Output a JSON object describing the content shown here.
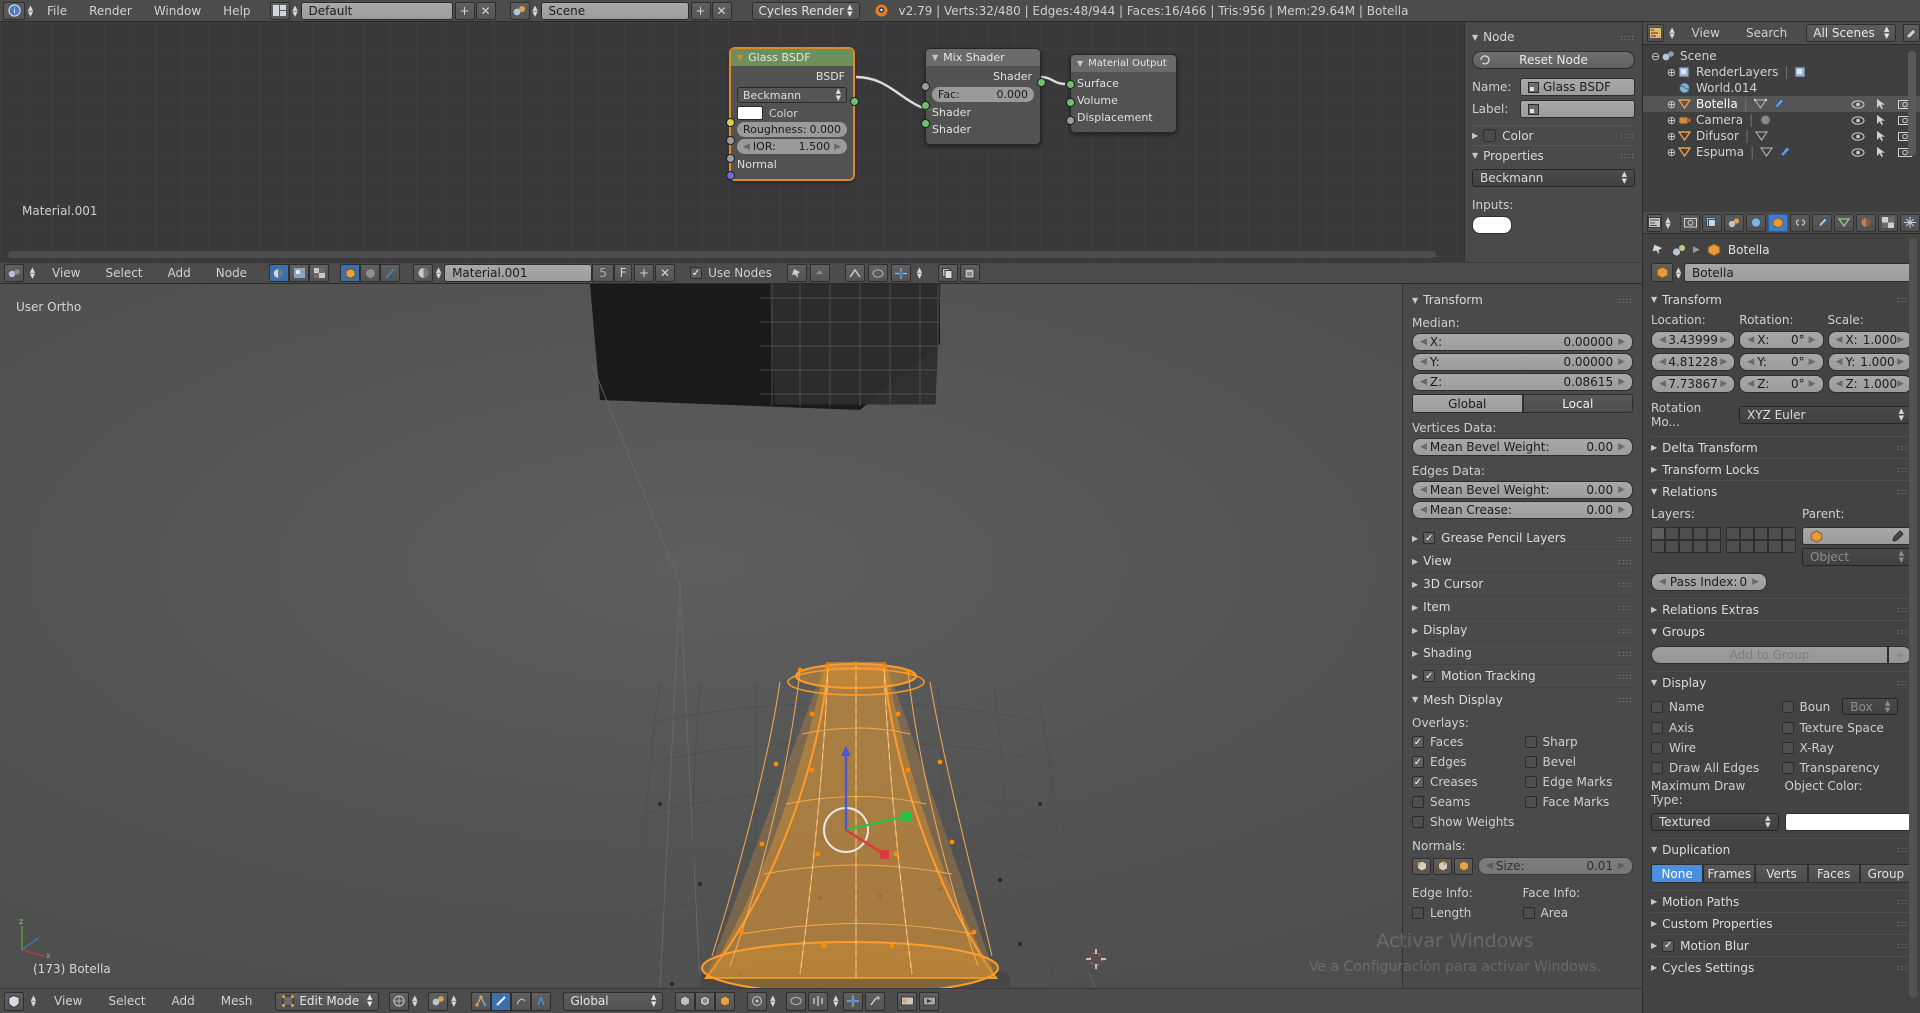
{
  "topbar": {
    "menus": [
      "File",
      "Render",
      "Window",
      "Help"
    ],
    "screen_layout": "Default",
    "scene": "Scene",
    "engine": "Cycles Render",
    "stats": "v2.79 | Verts:32/480 | Edges:48/944 | Faces:16/466 | Tris:956 | Mem:29.64M | Botella"
  },
  "node_editor": {
    "material_label": "Material.001",
    "header": {
      "menus": [
        "View",
        "Select",
        "Add",
        "Node"
      ],
      "material_name": "Material.001",
      "users_count": "5",
      "fake_user": "F",
      "use_nodes_label": "Use Nodes"
    },
    "nodes": [
      {
        "title": "Glass BSDF",
        "output_label": "BSDF",
        "distribution": "Beckmann",
        "color_label": "Color",
        "roughness_label": "Roughness:",
        "roughness_value": "0.000",
        "ior_label": "IOR:",
        "ior_value": "1.500",
        "normal_label": "Normal"
      },
      {
        "title": "Mix Shader",
        "output_label": "Shader",
        "fac_label": "Fac:",
        "fac_value": "0.000",
        "shader_a": "Shader",
        "shader_b": "Shader"
      },
      {
        "title": "Material Output",
        "surface": "Surface",
        "volume": "Volume",
        "displacement": "Displacement"
      }
    ],
    "npanel": {
      "node_title": "Node",
      "reset_node": "Reset Node",
      "name_label": "Name:",
      "name_value": "Glass BSDF",
      "label_label": "Label:",
      "label_value": "",
      "color_title": "Color",
      "properties_title": "Properties",
      "distribution": "Beckmann",
      "inputs_label": "Inputs:"
    }
  },
  "viewport": {
    "view_label": "User Ortho",
    "object_label": "(173) Botella",
    "header": {
      "menus": [
        "View",
        "Select",
        "Add",
        "Mesh"
      ],
      "mode": "Edit Mode",
      "orientation": "Global"
    }
  },
  "vp_npanel": {
    "transform_title": "Transform",
    "median_label": "Median:",
    "median": [
      {
        "axis": "X:",
        "value": "0.00000"
      },
      {
        "axis": "Y:",
        "value": "0.00000"
      },
      {
        "axis": "Z:",
        "value": "0.08615"
      }
    ],
    "space_buttons": [
      "Global",
      "Local"
    ],
    "space_selected": "Local",
    "vertices_data_label": "Vertices Data:",
    "vertices_bevel": {
      "label": "Mean Bevel Weight:",
      "value": "0.00"
    },
    "edges_data_label": "Edges Data:",
    "edges_bevel": {
      "label": "Mean Bevel Weight:",
      "value": "0.00"
    },
    "edges_crease": {
      "label": "Mean Crease:",
      "value": "0.00"
    },
    "collapsed_sections": [
      {
        "label": "Grease Pencil Layers",
        "checkbox": true
      },
      {
        "label": "View",
        "checkbox": false
      },
      {
        "label": "3D Cursor",
        "checkbox": false
      },
      {
        "label": "Item",
        "checkbox": false
      },
      {
        "label": "Display",
        "checkbox": false
      },
      {
        "label": "Shading",
        "checkbox": false
      },
      {
        "label": "Motion Tracking",
        "checkbox": true
      }
    ],
    "mesh_display_title": "Mesh Display",
    "overlays_label": "Overlays:",
    "overlays": [
      {
        "label": "Faces",
        "checked": true
      },
      {
        "label": "Sharp",
        "checked": false
      },
      {
        "label": "Edges",
        "checked": true
      },
      {
        "label": "Bevel",
        "checked": false
      },
      {
        "label": "Creases",
        "checked": true
      },
      {
        "label": "Edge Marks",
        "checked": false
      },
      {
        "label": "Seams",
        "checked": false
      },
      {
        "label": "Face Marks",
        "checked": false
      },
      {
        "label": "Show Weights",
        "checked": false
      }
    ],
    "normals_label": "Normals:",
    "normals_size_label": "Size:",
    "normals_size_value": "0.01",
    "edge_info_label": "Edge Info:",
    "face_info_label": "Face Info:",
    "edge_length": "Length",
    "face_area": "Area"
  },
  "outliner": {
    "header": {
      "view": "View",
      "search": "Search",
      "scope": "All Scenes"
    },
    "rows": [
      {
        "label": "Scene",
        "indent": 0,
        "expander": "-",
        "icon": "scene-icon",
        "selected": false
      },
      {
        "label": "RenderLayers",
        "indent": 1,
        "expander": "+",
        "icon": "renderlayers-icon",
        "selected": false
      },
      {
        "label": "World.014",
        "indent": 1,
        "expander": "",
        "icon": "world-icon",
        "selected": false
      },
      {
        "label": "Botella",
        "indent": 1,
        "expander": "+",
        "icon": "mesh-icon",
        "selected": true
      },
      {
        "label": "Camera",
        "indent": 1,
        "expander": "+",
        "icon": "camera-icon",
        "selected": false
      },
      {
        "label": "Difusor",
        "indent": 1,
        "expander": "+",
        "icon": "mesh-icon",
        "selected": false
      },
      {
        "label": "Espuma",
        "indent": 1,
        "expander": "+",
        "icon": "mesh-icon",
        "selected": false
      }
    ]
  },
  "properties": {
    "breadcrumb_object": "Botella",
    "object_name": "Botella",
    "transform": {
      "title": "Transform",
      "location_label": "Location:",
      "rotation_label": "Rotation:",
      "scale_label": "Scale:",
      "location": [
        "3.43999",
        "4.81228",
        "7.73867"
      ],
      "rotation": [
        {
          "axis": "X:",
          "value": "0°"
        },
        {
          "axis": "Y:",
          "value": "0°"
        },
        {
          "axis": "Z:",
          "value": "0°"
        }
      ],
      "scale": [
        {
          "axis": "X:",
          "value": "1.000"
        },
        {
          "axis": "Y:",
          "value": "1.000"
        },
        {
          "axis": "Z:",
          "value": "1.000"
        }
      ],
      "rotation_mode_label": "Rotation Mo...",
      "rotation_mode_value": "XYZ Euler"
    },
    "delta_transform_title": "Delta Transform",
    "transform_locks_title": "Transform Locks",
    "relations": {
      "title": "Relations",
      "layers_label": "Layers:",
      "parent_label": "Parent:",
      "parent_value": "",
      "parent_type": "Object",
      "pass_index_label": "Pass Index:",
      "pass_index_value": "0"
    },
    "relations_extras_title": "Relations Extras",
    "groups": {
      "title": "Groups",
      "add_to_group": "Add to Group"
    },
    "display": {
      "title": "Display",
      "options": [
        {
          "label": "Name",
          "checked": false
        },
        {
          "label": "Boun",
          "checked": false
        },
        {
          "label": "Axis",
          "checked": false
        },
        {
          "label": "Texture Space",
          "checked": false
        },
        {
          "label": "Wire",
          "checked": false
        },
        {
          "label": "X-Ray",
          "checked": false
        },
        {
          "label": "Draw All Edges",
          "checked": false
        },
        {
          "label": "Transparency",
          "checked": false
        }
      ],
      "bounds_value": "Box",
      "max_draw_type_label": "Maximum Draw Type:",
      "max_draw_type_value": "Textured",
      "object_color_label": "Object Color:",
      "object_color": "#ffffff"
    },
    "duplication": {
      "title": "Duplication",
      "options": [
        "None",
        "Frames",
        "Verts",
        "Faces",
        "Group"
      ],
      "selected": "None"
    },
    "motion_paths_title": "Motion Paths",
    "custom_properties_title": "Custom Properties",
    "motion_blur_title": "Motion Blur",
    "cycles_settings_title": "Cycles Settings"
  },
  "watermark": {
    "line1": "Activar Windows",
    "line2": "Ve a Configuración para activar Windows."
  },
  "colors": {
    "accent_orange": "#e08a26",
    "accent_blue": "#4a8fe0",
    "shader_green": "#6ec06e",
    "panel_bg": "#4a4a4a",
    "header_bg": "#4c4c4c"
  }
}
